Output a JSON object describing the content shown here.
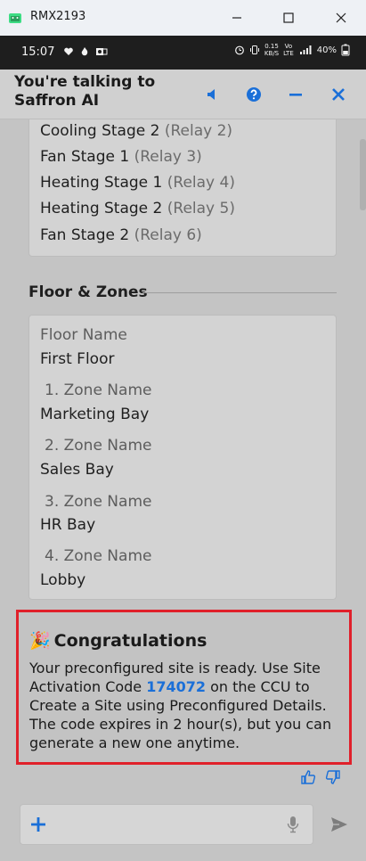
{
  "window": {
    "title": "RMX2193"
  },
  "statusbar": {
    "time": "15:07",
    "net_speed_top": "0.15",
    "net_speed_bottom": "KB/S",
    "volte_top": "Vo",
    "volte_bottom": "LTE",
    "signal": "⁴⁶ᴵ",
    "battery": "40%"
  },
  "header": {
    "title": "You're talking to Saffron AI"
  },
  "relays": [
    {
      "name": "Cooling Stage 2",
      "relay": "(Relay 2)"
    },
    {
      "name": "Fan Stage 1",
      "relay": "(Relay 3)"
    },
    {
      "name": "Heating Stage 1",
      "relay": "(Relay 4)"
    },
    {
      "name": "Heating Stage 2",
      "relay": "(Relay 5)"
    },
    {
      "name": "Fan Stage 2",
      "relay": "(Relay 6)"
    }
  ],
  "floor_section": {
    "title": "Floor & Zones",
    "floor_label": "Floor Name",
    "floor_value": "First Floor",
    "zones": [
      {
        "label": "1. Zone Name",
        "value": "Marketing Bay"
      },
      {
        "label": "2. Zone Name",
        "value": "Sales Bay"
      },
      {
        "label": "3. Zone Name",
        "value": "HR Bay"
      },
      {
        "label": "4. Zone Name",
        "value": "Lobby"
      }
    ]
  },
  "congrats": {
    "emoji": "🎉",
    "title": "Congratulations",
    "text_before": "Your preconfigured site is ready. Use Site Activation Code ",
    "code": "174072",
    "text_after": " on the CCU to Create a Site using Preconfigured Details. The code expires in 2 hour(s), but you can generate a new one anytime."
  },
  "composer": {
    "placeholder": ""
  },
  "colors": {
    "accent": "#1a6fd8",
    "highlight": "#e0202a"
  }
}
